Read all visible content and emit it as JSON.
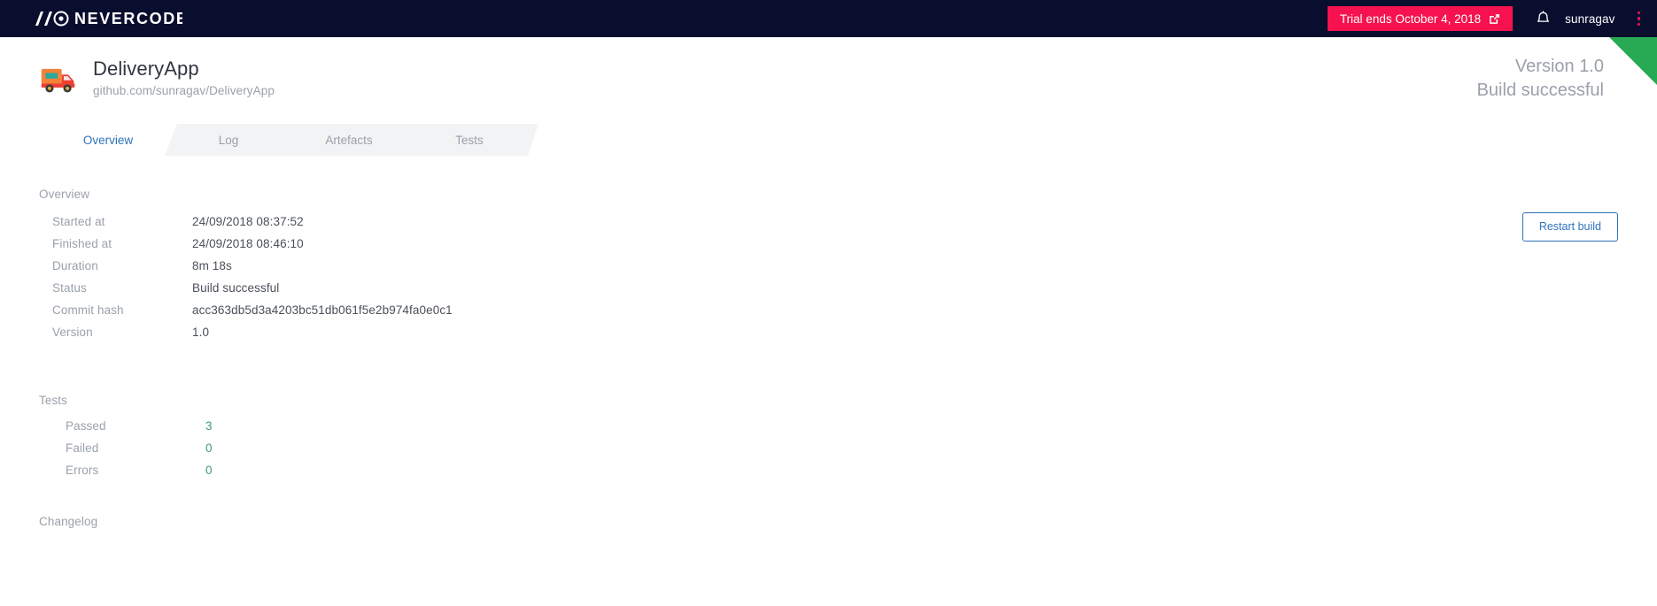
{
  "topnav": {
    "logo_text": "NEVERCODE",
    "logo_icon": "slash-slash-circle-logo",
    "trial_label": "Trial ends October 4, 2018",
    "trial_icon": "external-link-icon",
    "bell_icon": "bell-icon",
    "username": "sunragav",
    "kebab_icon": "kebab-menu-icon",
    "bg_color": "#0a0e2e",
    "accent_color": "#f5124e"
  },
  "app_header": {
    "icon": "delivery-truck-icon",
    "title": "DeliveryApp",
    "repo": "github.com/sunragav/DeliveryApp",
    "version_line": "Version 1.0",
    "status_line": "Build successful",
    "corner_flag_color": "#28aa54"
  },
  "tabs": [
    {
      "label": "Overview",
      "active": true
    },
    {
      "label": "Log",
      "active": false
    },
    {
      "label": "Artefacts",
      "active": false
    },
    {
      "label": "Tests",
      "active": false
    }
  ],
  "overview": {
    "section_title": "Overview",
    "restart_label": "Restart build",
    "rows": [
      {
        "label": "Started at",
        "value": "24/09/2018 08:37:52"
      },
      {
        "label": "Finished at",
        "value": "24/09/2018 08:46:10"
      },
      {
        "label": "Duration",
        "value": "8m 18s"
      },
      {
        "label": "Status",
        "value": "Build successful"
      },
      {
        "label": "Commit hash",
        "value": "acc363db5d3a4203bc51db061f5e2b974fa0e0c1"
      },
      {
        "label": "Version",
        "value": "1.0"
      }
    ]
  },
  "tests": {
    "section_title": "Tests",
    "rows": [
      {
        "label": "Passed",
        "value": "3"
      },
      {
        "label": "Failed",
        "value": "0"
      },
      {
        "label": "Errors",
        "value": "0"
      }
    ],
    "value_color": "#3f9a70"
  },
  "changelog": {
    "section_title": "Changelog"
  }
}
